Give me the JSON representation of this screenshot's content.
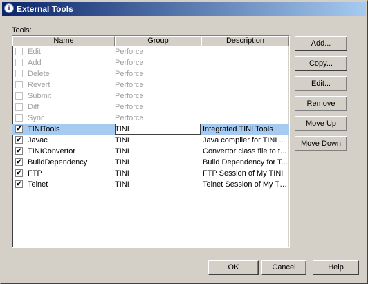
{
  "window": {
    "title": "External Tools"
  },
  "tools_label": "Tools:",
  "table": {
    "columns": [
      "Name",
      "Group",
      "Description"
    ],
    "rows": [
      {
        "checked": false,
        "enabled": false,
        "name": "Edit",
        "group": "Perforce",
        "description": ""
      },
      {
        "checked": false,
        "enabled": false,
        "name": "Add",
        "group": "Perforce",
        "description": ""
      },
      {
        "checked": false,
        "enabled": false,
        "name": "Delete",
        "group": "Perforce",
        "description": ""
      },
      {
        "checked": false,
        "enabled": false,
        "name": "Revert",
        "group": "Perforce",
        "description": ""
      },
      {
        "checked": false,
        "enabled": false,
        "name": "Submit",
        "group": "Perforce",
        "description": ""
      },
      {
        "checked": false,
        "enabled": false,
        "name": "Diff",
        "group": "Perforce",
        "description": ""
      },
      {
        "checked": false,
        "enabled": false,
        "name": "Sync",
        "group": "Perforce",
        "description": ""
      },
      {
        "checked": true,
        "enabled": true,
        "selected": true,
        "name": "TINITools",
        "group": "TINI",
        "description": "Integrated TINI Tools"
      },
      {
        "checked": true,
        "enabled": true,
        "name": "Javac",
        "group": "TINI",
        "description": "Java compiler for TINI ..."
      },
      {
        "checked": true,
        "enabled": true,
        "name": "TINIConvertor",
        "group": "TINI",
        "description": "Convertor class file to t..."
      },
      {
        "checked": true,
        "enabled": true,
        "name": "BuildDependency",
        "group": "TINI",
        "description": "Build Dependency for T..."
      },
      {
        "checked": true,
        "enabled": true,
        "name": "FTP",
        "group": "TINI",
        "description": "FTP Session of My TINI"
      },
      {
        "checked": true,
        "enabled": true,
        "name": "Telnet",
        "group": "TINI",
        "description": "Telnet Session of My TINI"
      }
    ]
  },
  "side_buttons": {
    "add": "Add...",
    "copy": "Copy...",
    "edit": "Edit...",
    "remove": "Remove",
    "move_up": "Move Up",
    "move_down": "Move Down"
  },
  "footer_buttons": {
    "ok": "OK",
    "cancel": "Cancel",
    "help": "Help"
  },
  "colors": {
    "title_start": "#0a246a",
    "title_end": "#a6caf0",
    "selection": "#a6caf0",
    "face": "#d4d0c8"
  }
}
